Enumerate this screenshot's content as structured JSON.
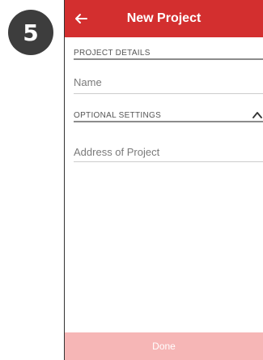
{
  "step": {
    "number": "5"
  },
  "appbar": {
    "title": "New Project",
    "back_icon": "arrow-left-icon",
    "color": "#d32f2f"
  },
  "sections": {
    "project_details": {
      "header": "PROJECT DETAILS",
      "fields": {
        "name": {
          "placeholder": "Name",
          "value": ""
        }
      }
    },
    "optional_settings": {
      "header": "OPTIONAL SETTINGS",
      "expanded": true,
      "toggle_icon": "chevron-up-icon",
      "fields": {
        "address": {
          "placeholder": "Address of Project",
          "value": ""
        }
      }
    }
  },
  "footer": {
    "done_label": "Done",
    "enabled": false,
    "color": "#f6b6b6"
  }
}
